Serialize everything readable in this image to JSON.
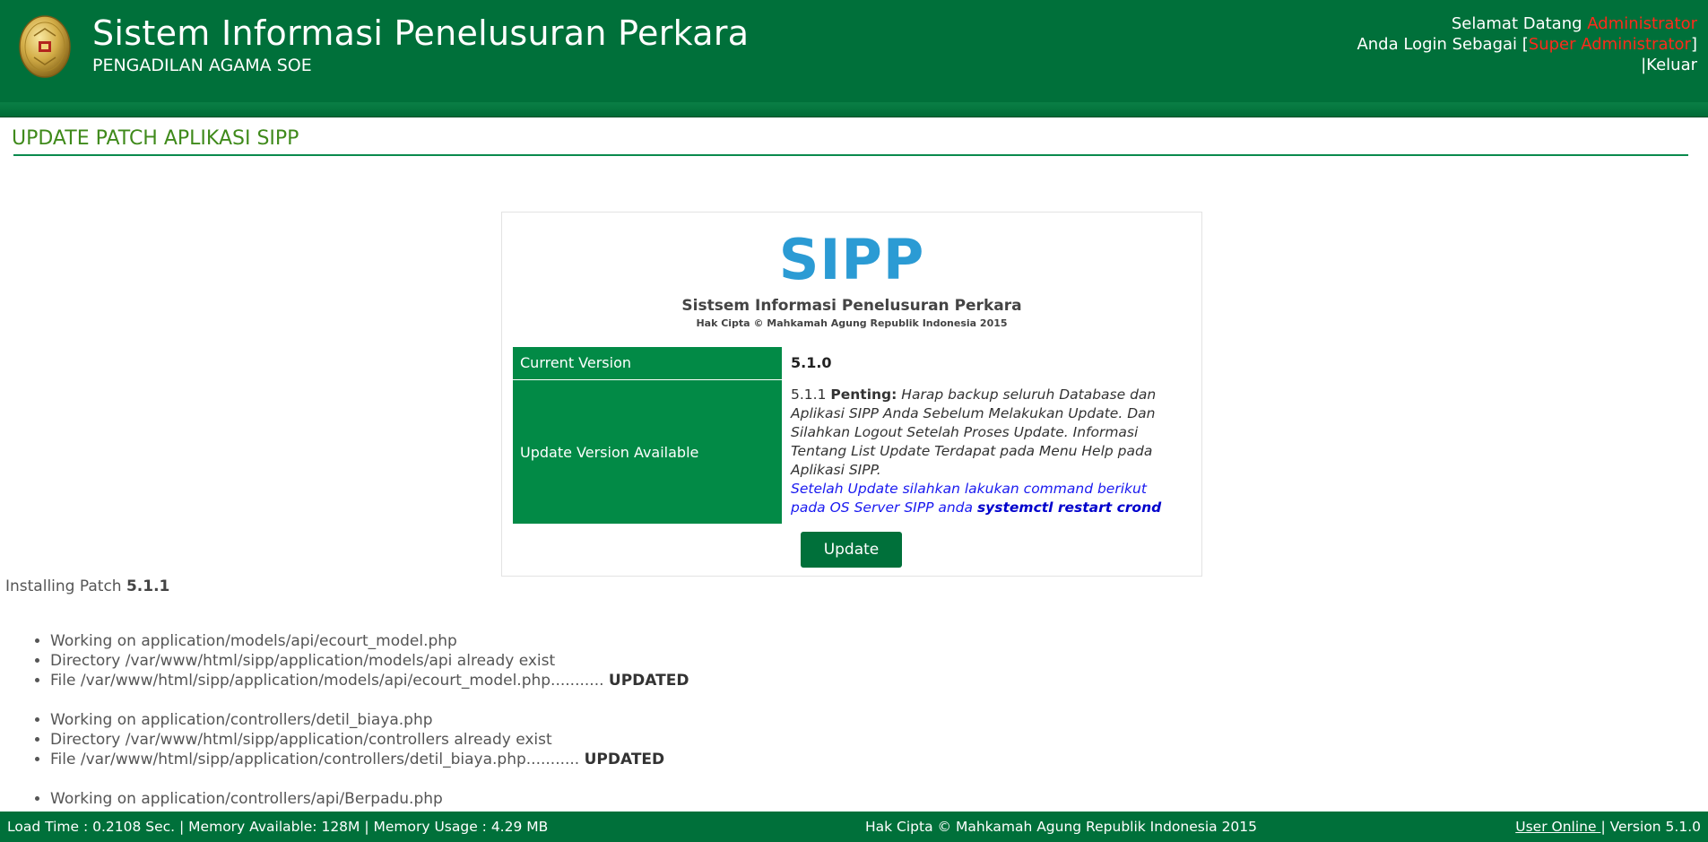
{
  "header": {
    "title": "Sistem Informasi Penelusuran Perkara",
    "subtitle": "PENGADILAN AGAMA SOE",
    "welcome_prefix": "Selamat Datang ",
    "welcome_user": "Administrator",
    "login_prefix": "Anda Login Sebagai [",
    "login_role": "Super Administrator",
    "login_suffix": "]",
    "logout_label": "|Keluar"
  },
  "page_title": "UPDATE PATCH APLIKASI SIPP",
  "panel": {
    "logo_text": "SIPP",
    "subtitle": "Sistsem Informasi Penelusuran Perkara",
    "copyright": "Hak Cipta © Mahkamah Agung Republik Indonesia 2015",
    "current_version_label": "Current Version",
    "current_version_value": "5.1.0",
    "update_label": "Update Version Available",
    "update_version": "5.1.1",
    "penting_label": "Penting:",
    "penting_text": "Harap backup seluruh Database dan Aplikasi SIPP Anda Sebelum Melakukan Update. Dan Silahkan Logout Setelah Proses Update. Informasi Tentang List Update Terdapat pada Menu Help pada Aplikasi SIPP.",
    "command_text": "Setelah Update silahkan lakukan command berikut pada OS Server SIPP anda",
    "command": "systemctl restart crond",
    "update_button": "Update"
  },
  "install": {
    "prefix": "Installing Patch",
    "version": "5.1.1",
    "groups": [
      {
        "working": "Working on application/models/api/ecourt_model.php",
        "directory": "Directory /var/www/html/sipp/application/models/api already exist",
        "file": "File /var/www/html/sipp/application/models/api/ecourt_model.php...........",
        "status": "UPDATED"
      },
      {
        "working": "Working on application/controllers/detil_biaya.php",
        "directory": "Directory /var/www/html/sipp/application/controllers already exist",
        "file": "File /var/www/html/sipp/application/controllers/detil_biaya.php...........",
        "status": "UPDATED"
      }
    ],
    "last_working": "Working on application/controllers/api/Berpadu.php"
  },
  "footer": {
    "stats": "Load Time : 0.2108 Sec. | Memory Available: 128M | Memory Usage : 4.29 MB",
    "copyright": "Hak Cipta © Mahkamah Agung Republik Indonesia 2015",
    "user_online": "User Online ",
    "separator": "|",
    "version": "Version 5.1.0"
  },
  "colors": {
    "header_green": "#00703a",
    "label_green": "#028a46",
    "title_green": "#3f8a1b",
    "sipp_blue": "#2b9bd4",
    "alert_red": "#ff2a1a",
    "command_blue": "#1a1af0"
  },
  "icons": {
    "logo": "mahkamah-agung-emblem-icon"
  }
}
